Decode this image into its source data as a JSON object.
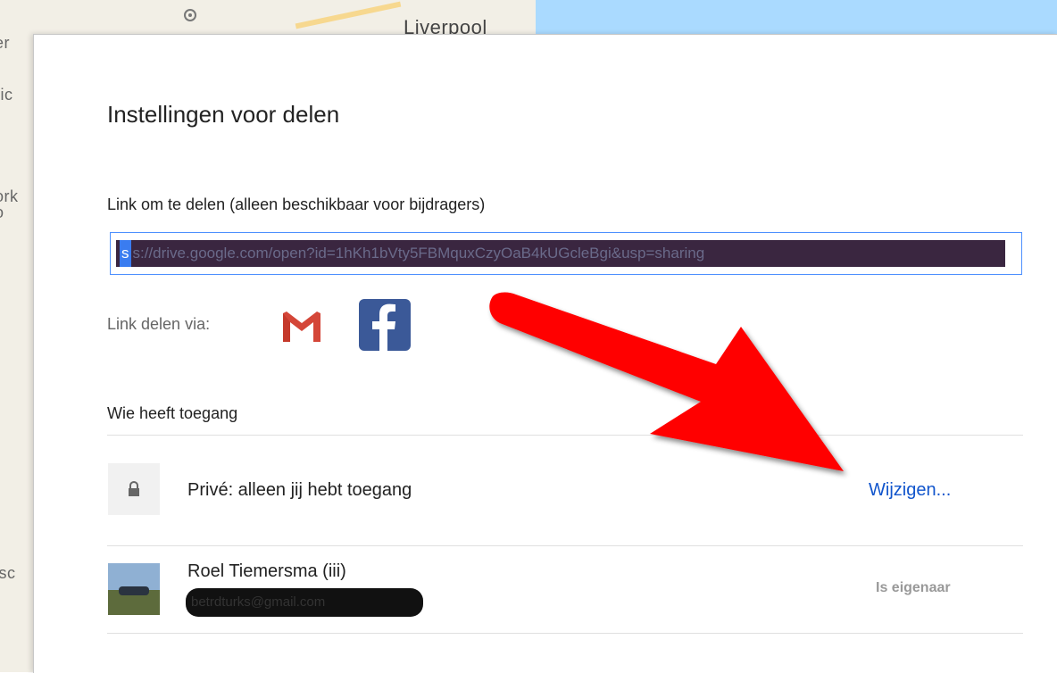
{
  "map": {
    "city_label": "Liverpool",
    "side_labels": [
      "er",
      "ric",
      "ork",
      "o",
      "isc"
    ]
  },
  "dialog": {
    "title": "Instellingen voor delen",
    "link_label": "Link om te delen (alleen beschikbaar voor bijdragers)",
    "link_value": "s://drive.google.com/open?id=1hKh1bVty5FBMquxCzyOaB4kUGcleBgi&usp=sharing",
    "share_via_label": "Link delen via:",
    "share_icons": [
      "gmail-icon",
      "facebook-icon"
    ],
    "who_has_access_label": "Wie heeft toegang",
    "access_row": {
      "icon": "lock-icon",
      "text": "Privé: alleen jij hebt toegang",
      "change_label": "Wijzigen..."
    },
    "user_row": {
      "name": "Roel Tiemersma (iii)",
      "email": "betrdturks@gmail.com",
      "role": "Is eigenaar"
    }
  },
  "colors": {
    "link_blue": "#1155cc",
    "input_focus": "#4d90fe",
    "facebook": "#3b5998",
    "annotation_arrow": "#ff0000"
  }
}
